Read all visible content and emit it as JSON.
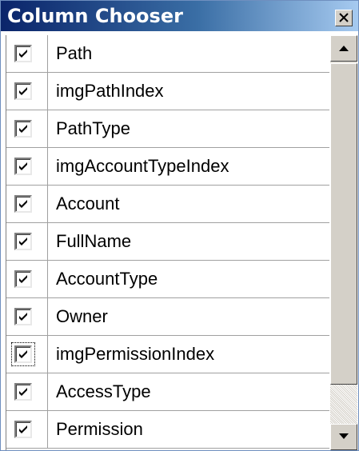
{
  "window": {
    "title": "Column Chooser",
    "close_icon": "close-icon"
  },
  "columns": [
    {
      "label": "Path",
      "checked": true
    },
    {
      "label": "imgPathIndex",
      "checked": true
    },
    {
      "label": "PathType",
      "checked": true
    },
    {
      "label": "imgAccountTypeIndex",
      "checked": true
    },
    {
      "label": "Account",
      "checked": true
    },
    {
      "label": "FullName",
      "checked": true
    },
    {
      "label": "AccountType",
      "checked": true
    },
    {
      "label": "Owner",
      "checked": true
    },
    {
      "label": "imgPermissionIndex",
      "checked": true,
      "focused": true
    },
    {
      "label": "AccessType",
      "checked": true
    },
    {
      "label": "Permission",
      "checked": true
    }
  ],
  "colors": {
    "title_start": "#0a246a",
    "title_end": "#a6caf0",
    "face": "#d4d0c8"
  }
}
